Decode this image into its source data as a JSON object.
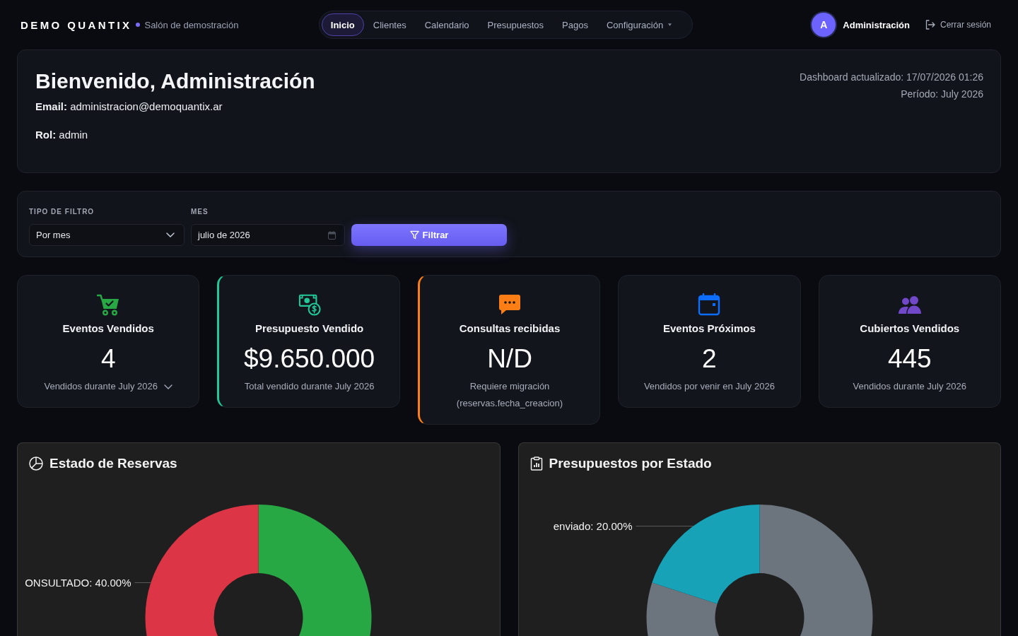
{
  "header": {
    "brand": "DEMO QUANTIX",
    "subtitle": "Salón de demostración",
    "nav": [
      {
        "label": "Inicio",
        "selected": true,
        "dropdown": false
      },
      {
        "label": "Clientes",
        "selected": false,
        "dropdown": false
      },
      {
        "label": "Calendario",
        "selected": false,
        "dropdown": false
      },
      {
        "label": "Presupuestos",
        "selected": false,
        "dropdown": false
      },
      {
        "label": "Pagos",
        "selected": false,
        "dropdown": false
      },
      {
        "label": "Configuración",
        "selected": false,
        "dropdown": true
      }
    ],
    "user": {
      "initial": "A",
      "name": "Administración"
    },
    "logout": "Cerrar sesión"
  },
  "welcome": {
    "title": "Bienvenido, Administración",
    "email": "**Email:** administracion@demoquantix.ar",
    "role": "**Rol:** admin",
    "updated": "Dashboard actualizado: 17/07/2026 01:26",
    "period": "Período: July 2026"
  },
  "filter": {
    "fields": [
      {
        "label": "TIPO DE FILTRO",
        "kind": "select",
        "value": "Por mes"
      },
      {
        "label": "MES",
        "kind": "month",
        "value": "julio de 2026"
      }
    ],
    "button": "Filtrar"
  },
  "kpis": [
    {
      "kind": "cart",
      "color": "#28a745",
      "highlighted": false,
      "collapsible": true,
      "title": "Eventos Vendidos",
      "value": "4",
      "note": "Vendidos durante July 2026"
    },
    {
      "kind": "money",
      "color": "#20c997",
      "highlighted": true,
      "collapsible": false,
      "title": "Presupuesto Vendido",
      "value": "$9.650.000",
      "note": "Total vendido durante July 2026"
    },
    {
      "kind": "chat",
      "color": "#fd7e14",
      "highlighted": true,
      "collapsible": false,
      "title": "Consultas recibidas",
      "value": "N/D",
      "note": "Requiere migración (reservas.fecha_creacion)"
    },
    {
      "kind": "calendar",
      "color": "#0d6efd",
      "highlighted": false,
      "collapsible": false,
      "title": "Eventos Próximos",
      "value": "2",
      "note": "Vendidos por venir en July 2026"
    },
    {
      "kind": "people",
      "color": "#7048c8",
      "highlighted": false,
      "collapsible": false,
      "title": "Cubiertos Vendidos",
      "value": "445",
      "note": "Vendidos durante July 2026"
    }
  ],
  "charts": [
    {
      "kind": "pie",
      "title": "Estado de Reservas",
      "chart_data": {
        "type": "donut",
        "values": [
          60,
          40
        ],
        "colors": [
          "#28a745",
          "#dc3545"
        ],
        "value_labels": [
          null,
          "ONSULTADO: 40.00%"
        ]
      }
    },
    {
      "kind": "clipboard",
      "title": "Presupuestos por Estado",
      "chart_data": {
        "type": "donut",
        "values": [
          80,
          20
        ],
        "colors": [
          "#6c757d",
          "#17a2b8"
        ],
        "value_labels": [
          null,
          "enviado: 20.00%"
        ]
      }
    }
  ]
}
